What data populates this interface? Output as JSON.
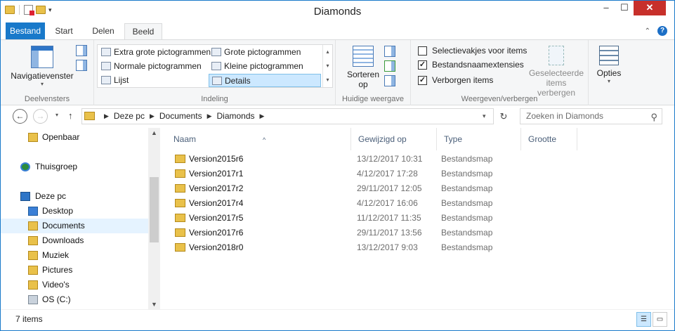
{
  "window": {
    "title": "Diamonds",
    "minimize_glyph": "–",
    "maximize_glyph": "☐",
    "close_glyph": "✕"
  },
  "ribbon_tabs": [
    {
      "label": "Bestand"
    },
    {
      "label": "Start"
    },
    {
      "label": "Delen"
    },
    {
      "label": "Beeld"
    }
  ],
  "ribbon": {
    "panes": {
      "nav_pane_label": "Navigatievenster",
      "group_label": "Deelvensters"
    },
    "layout": {
      "options": [
        {
          "label": "Extra grote pictogrammen"
        },
        {
          "label": "Grote pictogrammen"
        },
        {
          "label": "Normale pictogrammen"
        },
        {
          "label": "Kleine pictogrammen"
        },
        {
          "label": "Lijst"
        },
        {
          "label": "Details"
        }
      ],
      "group_label": "Indeling"
    },
    "current_view": {
      "sort_label_1": "Sorteren",
      "sort_label_2": "op",
      "group_label": "Huidige weergave"
    },
    "show_hide": {
      "checkboxes": [
        {
          "label": "Selectievakjes voor items",
          "checked": false
        },
        {
          "label": "Bestandsnaamextensies",
          "checked": true
        },
        {
          "label": "Verborgen items",
          "checked": true
        }
      ],
      "hide_selected_1": "Geselecteerde",
      "hide_selected_2": "items verbergen",
      "group_label": "Weergeven/verbergen"
    },
    "options_label": "Opties"
  },
  "address": {
    "crumbs": [
      "Deze pc",
      "Documents",
      "Diamonds"
    ],
    "search_placeholder": "Zoeken in Diamonds"
  },
  "nav_pane": {
    "items": [
      {
        "label": "Openbaar"
      },
      {
        "label": "Thuisgroep"
      },
      {
        "label": "Deze pc"
      },
      {
        "label": "Desktop"
      },
      {
        "label": "Documents"
      },
      {
        "label": "Downloads"
      },
      {
        "label": "Muziek"
      },
      {
        "label": "Pictures"
      },
      {
        "label": "Video's"
      },
      {
        "label": "OS (C:)"
      }
    ]
  },
  "columns": [
    "Naam",
    "Gewijzigd op",
    "Type",
    "Grootte"
  ],
  "rows": [
    {
      "name": "Version2015r6",
      "date": "13/12/2017 10:31",
      "type": "Bestandsmap"
    },
    {
      "name": "Version2017r1",
      "date": "4/12/2017 17:28",
      "type": "Bestandsmap"
    },
    {
      "name": "Version2017r2",
      "date": "29/11/2017 12:05",
      "type": "Bestandsmap"
    },
    {
      "name": "Version2017r4",
      "date": "4/12/2017 16:06",
      "type": "Bestandsmap"
    },
    {
      "name": "Version2017r5",
      "date": "11/12/2017 11:35",
      "type": "Bestandsmap"
    },
    {
      "name": "Version2017r6",
      "date": "29/11/2017 13:56",
      "type": "Bestandsmap"
    },
    {
      "name": "Version2018r0",
      "date": "13/12/2017 9:03",
      "type": "Bestandsmap"
    }
  ],
  "status": {
    "item_count": "7 items"
  },
  "icons": {
    "back": "←",
    "forward": "→",
    "up": "↑",
    "refresh": "↻",
    "search": "⚲",
    "check": "✓"
  }
}
